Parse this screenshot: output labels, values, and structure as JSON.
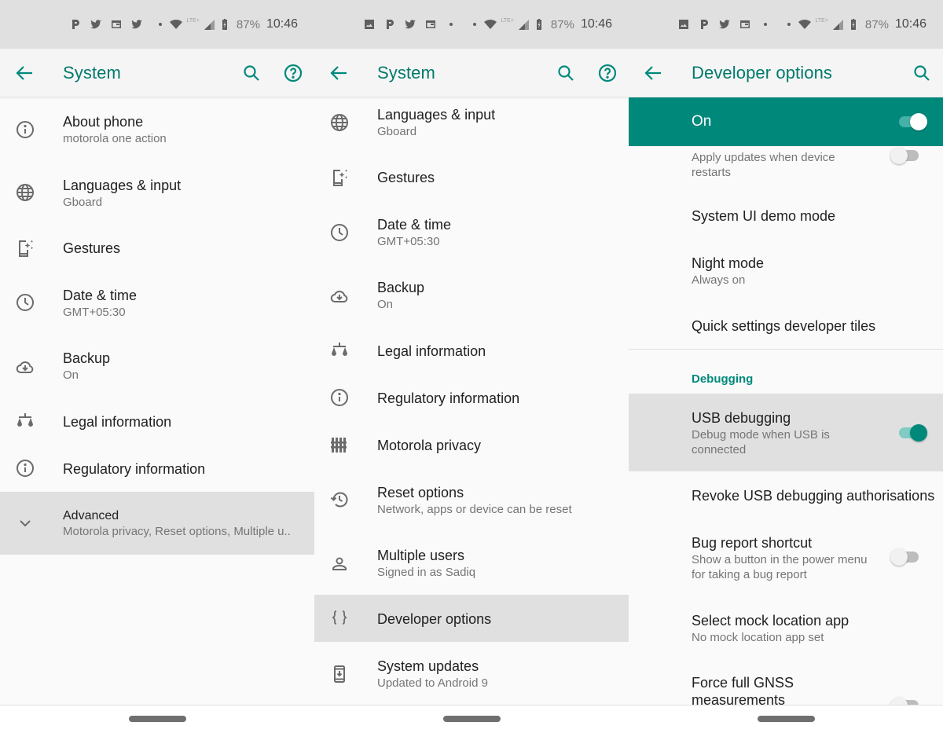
{
  "status_bars": [
    {
      "notif_icons": [
        "pinterest-icon",
        "twitter-icon",
        "calendar-icon",
        "twitter-icon"
      ],
      "battery": "87%",
      "time": "10:46",
      "network": "LTE+"
    },
    {
      "notif_icons": [
        "image-icon",
        "pinterest-icon",
        "twitter-icon",
        "calendar-icon"
      ],
      "battery": "87%",
      "time": "10:46",
      "network": "LTE+"
    },
    {
      "notif_icons": [
        "image-icon",
        "pinterest-icon",
        "twitter-icon",
        "calendar-icon"
      ],
      "battery": "87%",
      "time": "10:46",
      "network": "LTE+"
    }
  ],
  "colors": {
    "accent": "#00897b",
    "highlight": "#e0e0e0",
    "status_bar": "#e0e0e0"
  },
  "screen1": {
    "title": "System",
    "items": [
      {
        "icon": "info-icon",
        "title": "About phone",
        "subtitle": "motorola one action"
      },
      {
        "icon": "globe-icon",
        "title": "Languages & input",
        "subtitle": "Gboard"
      },
      {
        "icon": "gestures-icon",
        "title": "Gestures"
      },
      {
        "icon": "clock-icon",
        "title": "Date & time",
        "subtitle": "GMT+05:30"
      },
      {
        "icon": "cloud-backup-icon",
        "title": "Backup",
        "subtitle": "On"
      },
      {
        "icon": "scales-icon",
        "title": "Legal information"
      },
      {
        "icon": "info-icon",
        "title": "Regulatory information"
      },
      {
        "icon": "chevron-down-icon",
        "title": "Advanced",
        "subtitle": "Motorola privacy, Reset options, Multiple u..",
        "highlighted": true
      }
    ]
  },
  "screen2": {
    "title": "System",
    "items": [
      {
        "icon": "globe-icon",
        "title": "Languages & input",
        "subtitle": "Gboard"
      },
      {
        "icon": "gestures-icon",
        "title": "Gestures"
      },
      {
        "icon": "clock-icon",
        "title": "Date & time",
        "subtitle": "GMT+05:30"
      },
      {
        "icon": "cloud-backup-icon",
        "title": "Backup",
        "subtitle": "On"
      },
      {
        "icon": "scales-icon",
        "title": "Legal information"
      },
      {
        "icon": "info-icon",
        "title": "Regulatory information"
      },
      {
        "icon": "fence-icon",
        "title": "Motorola privacy"
      },
      {
        "icon": "history-icon",
        "title": "Reset options",
        "subtitle": "Network, apps or device can be reset"
      },
      {
        "icon": "person-icon",
        "title": "Multiple users",
        "subtitle": "Signed in as Sadiq"
      },
      {
        "icon": "braces-icon",
        "title": "Developer options",
        "highlighted": true
      },
      {
        "icon": "system-update-icon",
        "title": "System updates",
        "subtitle": "Updated to Android 9"
      }
    ]
  },
  "screen3": {
    "title": "Developer options",
    "master_switch": {
      "label": "On",
      "checked": true
    },
    "items": [
      {
        "subtitle": "Apply updates when device restarts",
        "toggle": false
      },
      {
        "title": "System UI demo mode"
      },
      {
        "title": "Night mode",
        "subtitle": "Always on"
      },
      {
        "title": "Quick settings developer tiles"
      }
    ],
    "section_header": "Debugging",
    "debug_items": [
      {
        "title": "USB debugging",
        "subtitle": "Debug mode when USB is connected",
        "toggle": true,
        "highlighted": true
      },
      {
        "title": "Revoke USB debugging authorisations"
      },
      {
        "title": "Bug report shortcut",
        "subtitle": "Show a button in the power menu for taking a bug report",
        "toggle": false
      },
      {
        "title": "Select mock location app",
        "subtitle": "No mock location app set"
      },
      {
        "title": "Force full GNSS measurements",
        "toggle": false
      }
    ]
  }
}
